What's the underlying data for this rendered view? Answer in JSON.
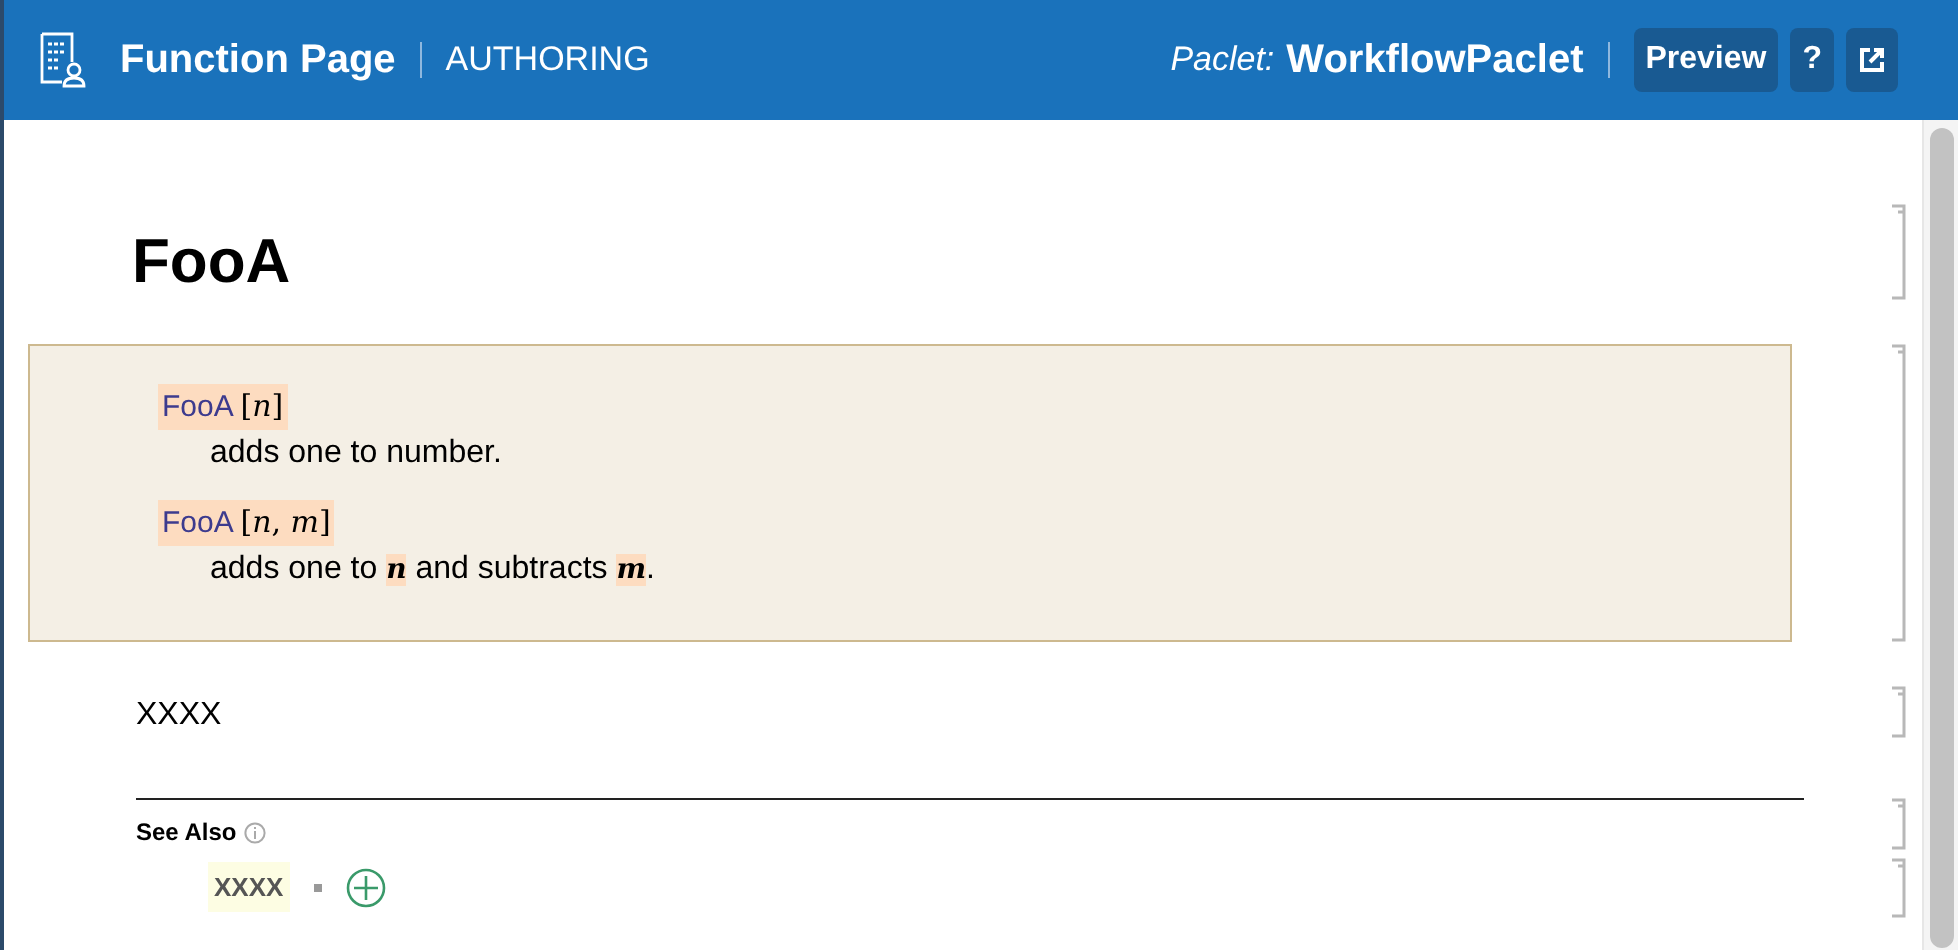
{
  "header": {
    "title": "Function Page",
    "mode": "AUTHORING",
    "paclet_label": "Paclet:",
    "paclet_name": "WorkflowPaclet",
    "buttons": [
      {
        "kind": "text",
        "label": "Preview"
      },
      {
        "kind": "text",
        "label": "?"
      },
      {
        "kind": "open-external"
      }
    ]
  },
  "page_title": "FooA",
  "usage": [
    {
      "function": "FooA",
      "args": "[*n*]",
      "description": [
        {
          "kind": "text",
          "text": "adds one to number."
        }
      ]
    },
    {
      "function": "FooA",
      "args": "[*n*, *m*]",
      "description": [
        {
          "kind": "text",
          "text": "adds one to "
        },
        {
          "kind": "var",
          "text": "n"
        },
        {
          "kind": "text",
          "text": " and subtracts "
        },
        {
          "kind": "var",
          "text": "m"
        },
        {
          "kind": "text",
          "text": "."
        }
      ]
    }
  ],
  "details": "XXXX",
  "see_also": {
    "heading": "See Also",
    "items": [
      "XXXX"
    ]
  }
}
